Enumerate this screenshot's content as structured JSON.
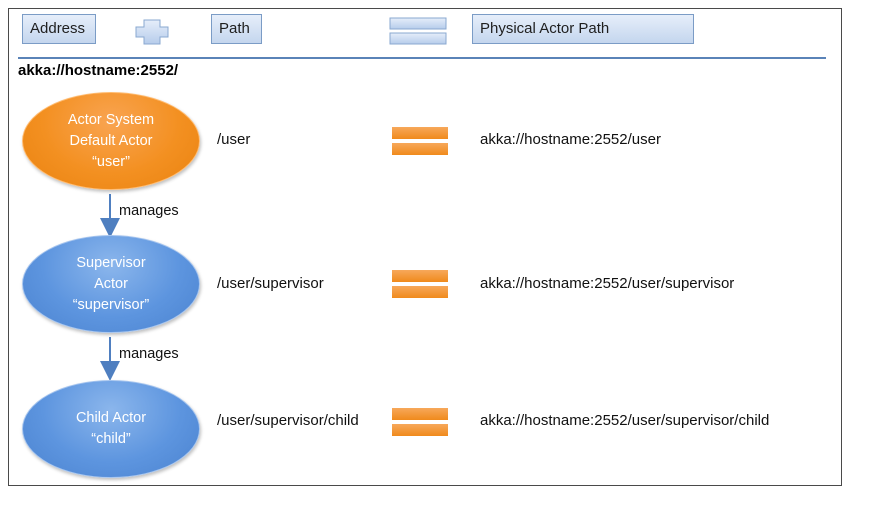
{
  "header": {
    "address_label": "Address",
    "path_label": "Path",
    "physical_label": "Physical Actor Path",
    "plus_icon": "plus-icon",
    "equals_icon": "equals-icon"
  },
  "address": "akka://hostname:2552/",
  "actors": [
    {
      "lines": [
        "Actor System",
        "Default Actor",
        "“user”"
      ],
      "path": "/user",
      "physical_path": "akka://hostname:2552/user"
    },
    {
      "lines": [
        "Supervisor",
        "Actor",
        "“supervisor”"
      ],
      "path": "/user/supervisor",
      "physical_path": "akka://hostname:2552/user/supervisor"
    },
    {
      "lines": [
        "Child Actor",
        "“child”"
      ],
      "path": "/user/supervisor/child",
      "physical_path": "akka://hostname:2552/user/supervisor/child"
    }
  ],
  "edge_labels": [
    "manages",
    "manages"
  ],
  "colors": {
    "header_blue": "#c4d6ee",
    "rule_blue": "#5a83b8",
    "actor_orange": "#f39021",
    "actor_blue": "#5d95df",
    "equals_orange": "#f08a1c",
    "arrow_blue": "#4f7fc0"
  }
}
